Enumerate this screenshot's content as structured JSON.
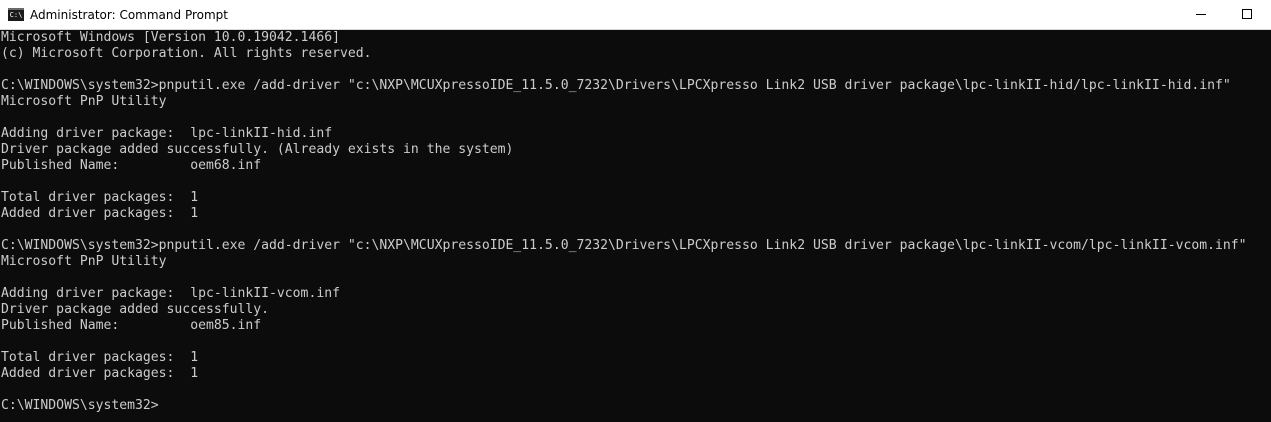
{
  "window": {
    "title": "Administrator: Command Prompt",
    "icon_label": "C:\\",
    "icon": "cmd-icon",
    "buttons": [
      "minimize-icon",
      "maximize-icon"
    ]
  },
  "colors": {
    "console_background": "#0c0c0c",
    "console_text": "#cccccc",
    "titlebar_background": "#ffffff"
  },
  "console": {
    "lines": [
      "Microsoft Windows [Version 10.0.19042.1466]",
      "(c) Microsoft Corporation. All rights reserved.",
      "",
      "C:\\WINDOWS\\system32>pnputil.exe /add-driver \"c:\\NXP\\MCUXpressoIDE_11.5.0_7232\\Drivers\\LPCXpresso Link2 USB driver package\\lpc-linkII-hid/lpc-linkII-hid.inf\"",
      "Microsoft PnP Utility",
      "",
      "Adding driver package:  lpc-linkII-hid.inf",
      "Driver package added successfully. (Already exists in the system)",
      "Published Name:         oem68.inf",
      "",
      "Total driver packages:  1",
      "Added driver packages:  1",
      "",
      "C:\\WINDOWS\\system32>pnputil.exe /add-driver \"c:\\NXP\\MCUXpressoIDE_11.5.0_7232\\Drivers\\LPCXpresso Link2 USB driver package\\lpc-linkII-vcom/lpc-linkII-vcom.inf\"",
      "Microsoft PnP Utility",
      "",
      "Adding driver package:  lpc-linkII-vcom.inf",
      "Driver package added successfully.",
      "Published Name:         oem85.inf",
      "",
      "Total driver packages:  1",
      "Added driver packages:  1",
      "",
      "C:\\WINDOWS\\system32>"
    ]
  }
}
